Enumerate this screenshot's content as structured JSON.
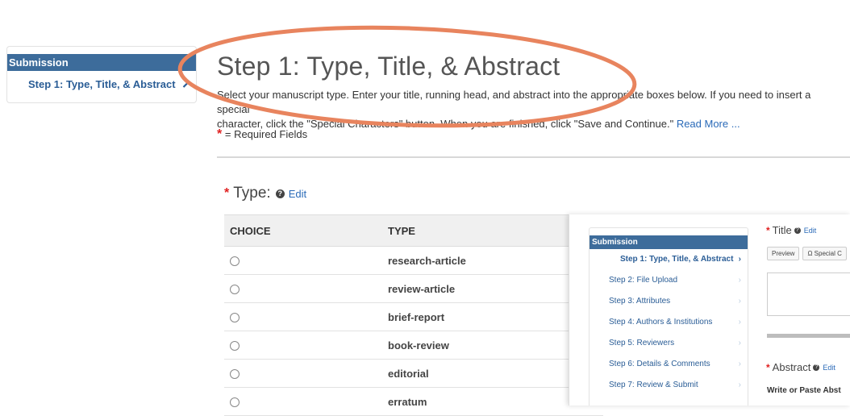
{
  "left_nav": {
    "header": "Submission",
    "active_item": "Step 1: Type, Title, & Abstract"
  },
  "page": {
    "title": "Step 1: Type, Title, & Abstract",
    "intro_line1": "Select your manuscript type. Enter your title, running head, and abstract into the appropriate boxes below. If you need to insert a special",
    "intro_line2": "character, click the \"Special Characters\" button. When you are finished, click \"Save and Continue.\" ",
    "read_more": "Read More ...",
    "required_note": "= Required Fields"
  },
  "type_section": {
    "heading": "Type:",
    "edit": "Edit",
    "columns": [
      "CHOICE",
      "TYPE"
    ],
    "rows": [
      "research-article",
      "review-article",
      "brief-report",
      "book-review",
      "editorial",
      "erratum"
    ]
  },
  "overlay": {
    "nav_header": "Submission",
    "steps": [
      "Step 1: Type, Title, & Abstract",
      "Step 2: File Upload",
      "Step 3: Attributes",
      "Step 4: Authors & Institutions",
      "Step 5: Reviewers",
      "Step 6: Details & Comments",
      "Step 7: Review & Submit"
    ],
    "title_label": "Title",
    "title_edit": "Edit",
    "preview_btn": "Preview",
    "special_btn": "Ω Special C",
    "abstract_label": "Abstract",
    "abstract_edit": "Edit",
    "write_paste": "Write or Paste Abst"
  },
  "colors": {
    "nav_header_bg": "#3d6c9b",
    "link": "#2a6ab8",
    "required_star": "#e02020",
    "annotation_ellipse": "#e8845e"
  }
}
